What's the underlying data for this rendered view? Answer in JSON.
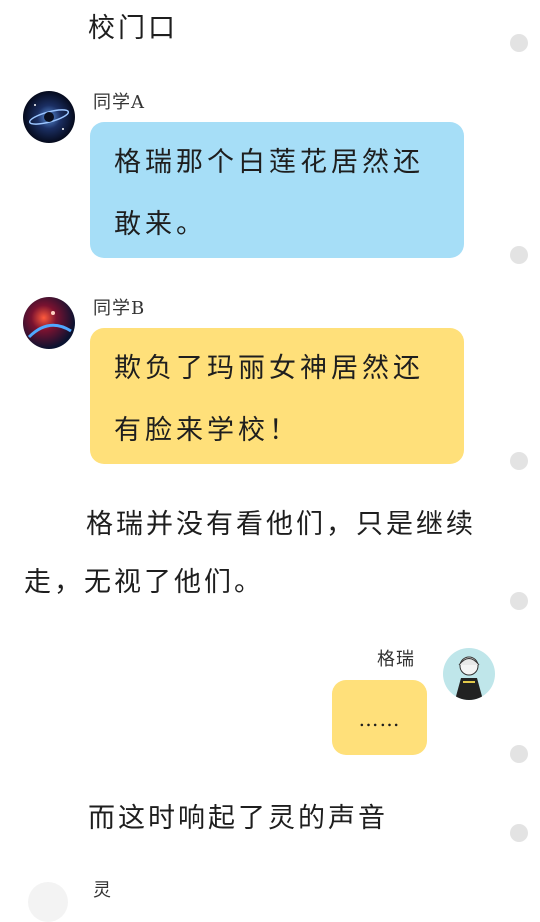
{
  "scene_title": "校门口",
  "messages": [
    {
      "speaker": "同学A",
      "text": "格瑞那个白莲花居然还敢来。",
      "bubble_color": "#a6def7",
      "avatar_icon": "galaxy-avatar-icon"
    },
    {
      "speaker": "同学B",
      "text": "欺负了玛丽女神居然还有脸来学校！",
      "bubble_color": "#ffe07a",
      "avatar_icon": "nebula-avatar-icon"
    },
    {
      "speaker": "格瑞",
      "text": "……",
      "bubble_color": "#ffe07a",
      "avatar_icon": "anime-character-avatar-icon"
    }
  ],
  "narration": [
    "格瑞并没有看他们，只是继续走，无视了他们。",
    "而这时响起了灵的声音"
  ],
  "next_speaker": "灵",
  "colors": {
    "blue_bubble": "#a6def7",
    "yellow_bubble": "#ffe07a",
    "dot": "#e3e3e3"
  }
}
